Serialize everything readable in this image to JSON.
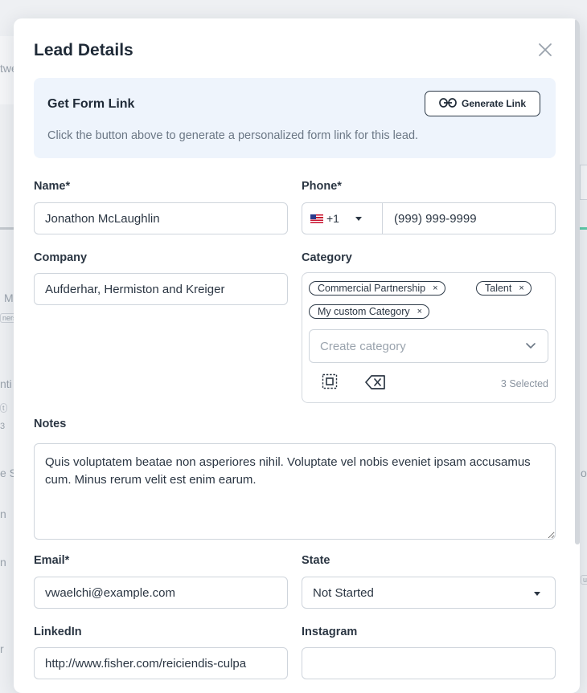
{
  "background": {
    "fragments": [
      "twe",
      "M",
      "ners",
      "nti",
      "t",
      "3",
      "e S",
      "n",
      "n",
      "r",
      "o",
      "u"
    ]
  },
  "modal": {
    "title": "Lead Details",
    "form_link": {
      "heading": "Get Form Link",
      "description": "Click the button above to generate a personalized form link for this lead.",
      "button_label": "Generate Link"
    },
    "name": {
      "label": "Name*",
      "value": "Jonathon McLaughlin"
    },
    "phone": {
      "label": "Phone*",
      "country_code": "+1",
      "placeholder": "(999) 999-9999"
    },
    "company": {
      "label": "Company",
      "value": "Aufderhar, Hermiston and Kreiger"
    },
    "category": {
      "label": "Category",
      "chips": [
        "Commercial Partnership",
        "Talent",
        "My custom Category"
      ],
      "chip_remove": "×",
      "placeholder": "Create category",
      "selected_count": "3 Selected"
    },
    "notes": {
      "label": "Notes",
      "value": "Quis voluptatem beatae non asperiores nihil. Voluptate vel nobis eveniet ipsam accusamus cum. Minus rerum velit est enim earum."
    },
    "email": {
      "label": "Email*",
      "value": "vwaelchi@example.com"
    },
    "state": {
      "label": "State",
      "value": "Not Started"
    },
    "linkedin": {
      "label": "LinkedIn",
      "value": "http://www.fisher.com/reiciendis-culpa"
    },
    "instagram": {
      "label": "Instagram",
      "value": ""
    }
  },
  "colors": {
    "accent_bg": "#eef4fc",
    "text": "#1f2a37",
    "muted": "#6b7785",
    "border": "#cfd5dc"
  }
}
